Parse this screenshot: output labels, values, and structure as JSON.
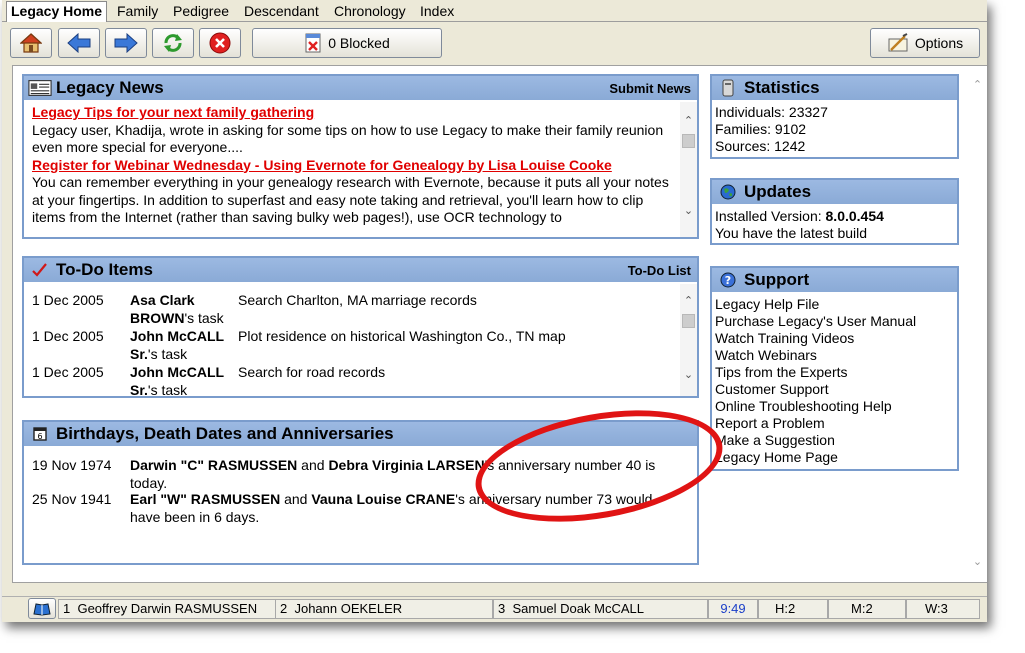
{
  "tabs": [
    {
      "label": "Legacy Home",
      "active": true
    },
    {
      "label": "Family"
    },
    {
      "label": "Pedigree"
    },
    {
      "label": "Descendant"
    },
    {
      "label": "Chronology"
    },
    {
      "label": "Index"
    }
  ],
  "toolbar": {
    "blocked_label": "0 Blocked",
    "options_label": "Options"
  },
  "news": {
    "title": "Legacy News",
    "submit_link": "Submit News",
    "items": [
      {
        "title": "Legacy Tips for your next family gathering",
        "body": "Legacy user, Khadija, wrote in asking for some tips on how to use Legacy to make their family reunion even more special for everyone...."
      },
      {
        "title": "Register for Webinar Wednesday - Using Evernote for Genealogy by Lisa Louise Cooke",
        "body": "You can remember everything in your genealogy research with Evernote, because it puts all your notes at your fingertips. In addition to superfast and easy note taking and retrieval, you'll learn how to clip items from the Internet (rather than saving bulky web pages!), use OCR technology to"
      }
    ]
  },
  "todo": {
    "title": "To-Do Items",
    "list_link": "To-Do List",
    "rows": [
      {
        "date": "1 Dec 2005",
        "name1": "Asa Clark",
        "name2": "BROWN",
        "suffix": "'s task",
        "desc": "Search Charlton, MA marriage records"
      },
      {
        "date": "1 Dec 2005",
        "name1": "John McCALL",
        "name2": "Sr.",
        "suffix": "'s task",
        "desc": "Plot residence on historical Washington Co., TN map"
      },
      {
        "date": "1 Dec 2005",
        "name1": "John McCALL",
        "name2": "Sr.",
        "suffix": "'s task",
        "desc": "Search for road records"
      }
    ]
  },
  "birthdays": {
    "title": "Birthdays, Death Dates and Anniversaries",
    "rows": [
      {
        "date": "19 Nov 1974",
        "p1": "Darwin \"C\" RASMUSSEN",
        "and": " and ",
        "p2": "Debra Virginia LARSEN",
        "rest1": "'s anniversary number 40 is",
        "rest2": "today."
      },
      {
        "date": "25 Nov 1941",
        "p1": "Earl \"W\" RASMUSSEN",
        "and": " and ",
        "p2": "Vauna Louise CRANE",
        "rest1": "'s anniversary number 73 would",
        "rest2": "have been in 6 days."
      }
    ]
  },
  "statistics": {
    "title": "Statistics",
    "lines": [
      "Individuals: 23327",
      "Families: 9102",
      "Sources: 1242"
    ]
  },
  "updates": {
    "title": "Updates",
    "version_label": "Installed Version: ",
    "version": "8.0.0.454",
    "status": "You have the latest build"
  },
  "support": {
    "title": "Support",
    "links": [
      "Legacy Help File",
      "Purchase Legacy's User Manual",
      "Watch Training Videos",
      "Watch Webinars",
      "Tips from the Experts",
      "Customer Support",
      "Online Troubleshooting Help",
      "Report a Problem",
      "Make a Suggestion",
      "Legacy Home Page"
    ]
  },
  "statusbar": {
    "n1": "1",
    "s1": "Geoffrey Darwin RASMUSSEN",
    "n2": "2",
    "s2": "Johann     OEKELER",
    "n3": "3",
    "s3": "Samuel Doak McCALL",
    "time": "9:49",
    "h": "H:2",
    "m": "M:2",
    "w": "W:3"
  },
  "colors": {
    "accent": "#e00000",
    "panel_header": "#8aaad6",
    "ring": "#e01414"
  }
}
